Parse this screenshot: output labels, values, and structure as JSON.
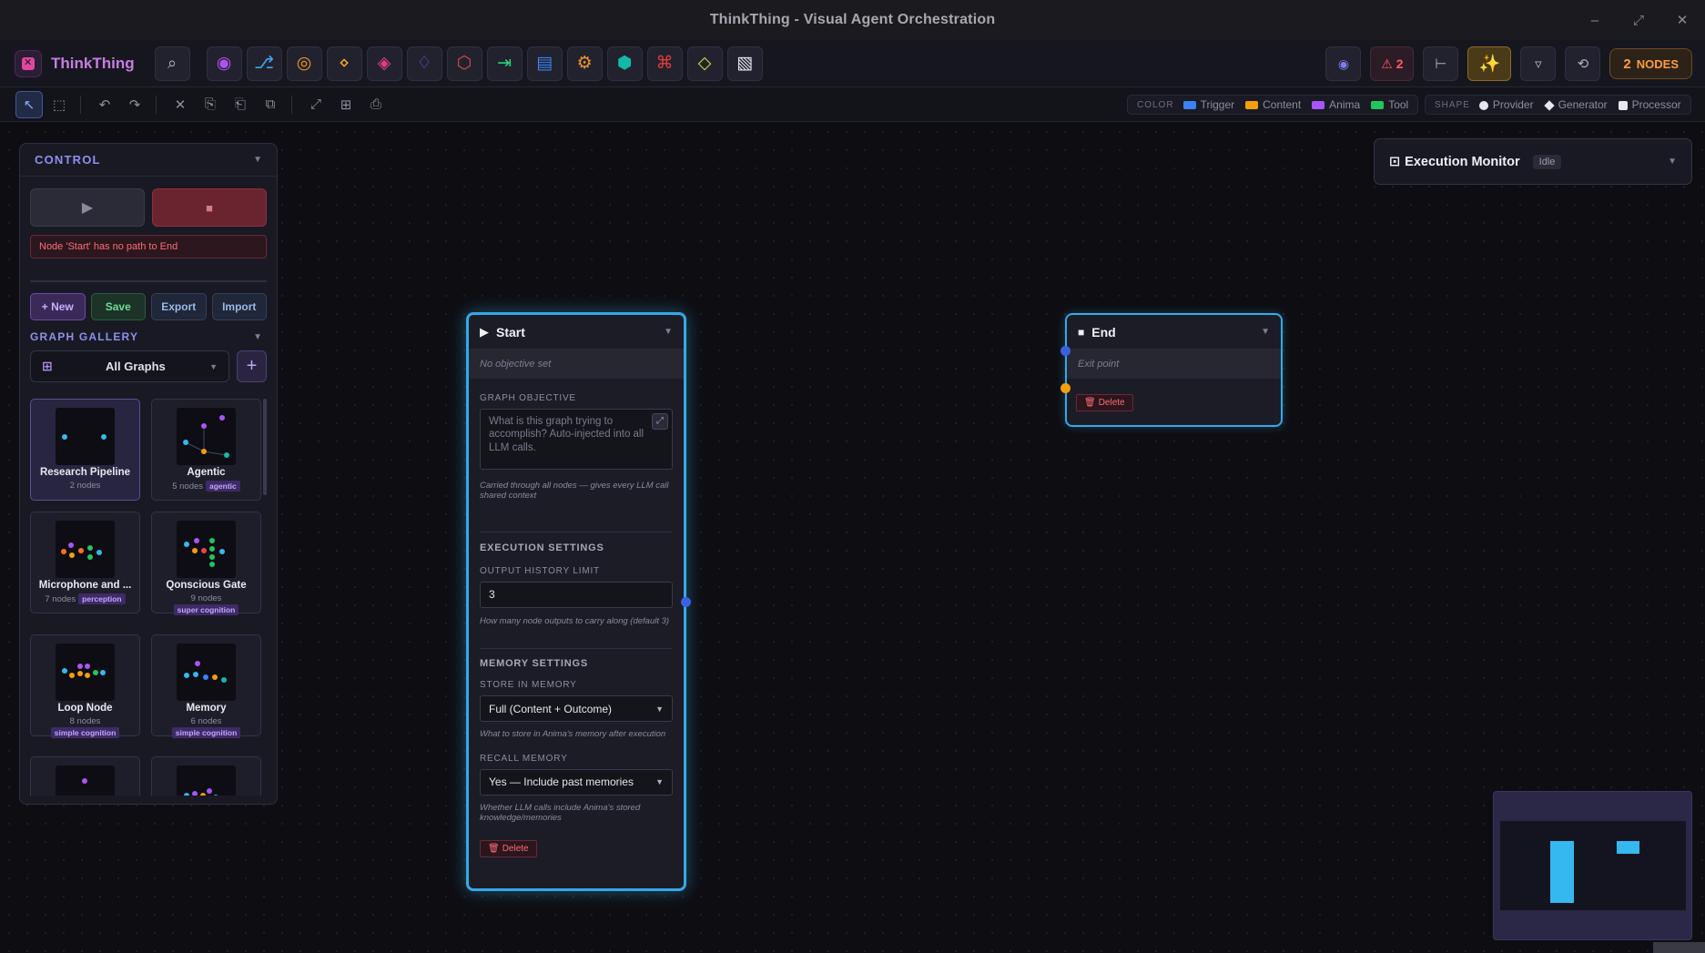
{
  "window": {
    "title": "ThinkThing - Visual Agent Orchestration",
    "controls": [
      "minimize-icon",
      "maximize-icon",
      "close-icon"
    ]
  },
  "brand": {
    "name": "ThinkThing",
    "color": "#c77de0"
  },
  "toolbar": {
    "node_tools": [
      {
        "icon": "◉",
        "name": "anima-node-icon",
        "color": "#b052e8"
      },
      {
        "icon": "⎇",
        "name": "branch-node-icon",
        "color": "#3aa8f0"
      },
      {
        "icon": "◎",
        "name": "target-node-icon",
        "color": "#f0972a"
      },
      {
        "icon": "⋄",
        "name": "diamond-small-icon",
        "color": "#f0a92a"
      },
      {
        "icon": "◈",
        "name": "diamond-node-icon",
        "color": "#e03c8c"
      },
      {
        "icon": "♢",
        "name": "diamond-outline-icon",
        "color": "#7a4ee0"
      },
      {
        "icon": "⬡",
        "name": "hexagon-node-icon",
        "color": "#e04a4a"
      },
      {
        "icon": "⇥",
        "name": "output-node-icon",
        "color": "#2ed07a"
      },
      {
        "icon": "▤",
        "name": "list-node-icon",
        "color": "#3a82f0"
      },
      {
        "icon": "⚙",
        "name": "gear-node-icon",
        "color": "#f0942a"
      },
      {
        "icon": "⬢",
        "name": "hexagon-filled-icon",
        "color": "#14b8a6"
      },
      {
        "icon": "⌘",
        "name": "command-node-icon",
        "color": "#e43c3c"
      },
      {
        "icon": "◇",
        "name": "condition-node-icon",
        "color": "#d8d83a"
      },
      {
        "icon": "▧",
        "name": "pattern-node-icon",
        "color": "#e6e6ee"
      }
    ],
    "right": {
      "eye_icon": "◉",
      "error_count": "2",
      "tree_icon": "⊢",
      "sparkle_icon": "✨",
      "filter_icon": "▿",
      "history_icon": "⟲",
      "nodes_count": "2",
      "nodes_label": "NODES"
    }
  },
  "toolbar2": {
    "tools": [
      {
        "icon": "↖",
        "name": "select-tool-icon",
        "active": true
      },
      {
        "icon": "⬚",
        "name": "marquee-tool-icon",
        "active": false
      }
    ],
    "edit_tools": [
      {
        "icon": "↶",
        "name": "undo-icon"
      },
      {
        "icon": "↷",
        "name": "redo-icon"
      }
    ],
    "clip_tools": [
      {
        "icon": "✕",
        "name": "delete-icon"
      },
      {
        "icon": "⎘",
        "name": "copy-icon"
      },
      {
        "icon": "⎗",
        "name": "paste-icon"
      },
      {
        "icon": "⧉",
        "name": "duplicate-icon"
      }
    ],
    "view_tools": [
      {
        "icon": "⤢",
        "name": "fit-view-icon"
      },
      {
        "icon": "⊞",
        "name": "grid-icon"
      },
      {
        "icon": "⎙",
        "name": "screenshot-icon"
      }
    ]
  },
  "legend": {
    "color_label": "COLOR",
    "colors": [
      {
        "label": "Trigger",
        "color": "#3b82f6"
      },
      {
        "label": "Content",
        "color": "#f59e0b"
      },
      {
        "label": "Anima",
        "color": "#a855f7"
      },
      {
        "label": "Tool",
        "color": "#22c55e"
      }
    ],
    "shape_label": "SHAPE",
    "shapes": [
      {
        "label": "Provider",
        "shape": "circle"
      },
      {
        "label": "Generator",
        "shape": "diamond"
      },
      {
        "label": "Processor",
        "shape": "square"
      }
    ]
  },
  "control": {
    "title": "CONTROL",
    "play_icon": "▶",
    "stop_icon": "■",
    "error": "Node 'Start' has no path to End",
    "actions": {
      "new": "+ New",
      "save": "Save",
      "export": "Export",
      "import": "Import"
    },
    "gallery_title": "GRAPH GALLERY",
    "filter_value": "All Graphs",
    "add_label": "+",
    "cards": [
      {
        "name": "Research Pipeline",
        "meta": "2 nodes",
        "tag": ""
      },
      {
        "name": "Agentic",
        "meta": "5 nodes",
        "tag": "agentic"
      },
      {
        "name": "Microphone and ...",
        "meta": "7 nodes",
        "tag": "perception"
      },
      {
        "name": "Qonscious Gate",
        "meta": "9 nodes",
        "tag": "super cognition"
      },
      {
        "name": "Loop Node",
        "meta": "8 nodes",
        "tag": "simple cognition"
      },
      {
        "name": "Memory",
        "meta": "6 nodes",
        "tag": "simple cognition"
      }
    ]
  },
  "start_node": {
    "title": "Start",
    "objective_status": "No objective set",
    "objective_label": "GRAPH OBJECTIVE",
    "objective_placeholder": "What is this graph trying to accomplish? Auto-injected into all LLM calls.",
    "objective_hint": "Carried through all nodes — gives every LLM call shared context",
    "execution_section": "EXECUTION SETTINGS",
    "history_label": "OUTPUT HISTORY LIMIT",
    "history_value": "3",
    "history_hint": "How many node outputs to carry along (default 3)",
    "memory_section": "MEMORY SETTINGS",
    "store_label": "STORE IN MEMORY",
    "store_value": "Full (Content + Outcome)",
    "store_hint": "What to store in Anima's memory after execution",
    "recall_label": "RECALL MEMORY",
    "recall_value": "Yes — Include past memories",
    "recall_hint": "Whether LLM calls include Anima's stored knowledge/memories",
    "delete_label": "Delete"
  },
  "end_node": {
    "title": "End",
    "subtitle": "Exit point",
    "delete_label": "Delete"
  },
  "monitor": {
    "title": "Execution Monitor",
    "status": "Idle"
  },
  "colors": {
    "accent": "#8f8ff0",
    "node_border": "#35a9e8",
    "error": "#ff6b7a"
  }
}
